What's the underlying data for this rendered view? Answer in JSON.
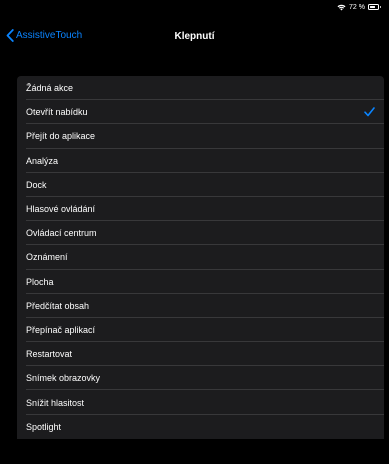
{
  "status_bar": {
    "battery_text": "72 %",
    "icons": [
      "wifi-icon",
      "battery-icon"
    ]
  },
  "nav": {
    "back_label": "AssistiveTouch",
    "title": "Klepnutí"
  },
  "colors": {
    "background": "#000000",
    "list_background": "#1c1c1e",
    "accent": "#0a84ff",
    "separator": "#38383a"
  },
  "list": {
    "selected_index": 1,
    "items": [
      {
        "label": "Žádná akce"
      },
      {
        "label": "Otevřít nabídku"
      },
      {
        "label": "Přejít do aplikace"
      },
      {
        "label": "Analýza"
      },
      {
        "label": "Dock"
      },
      {
        "label": "Hlasové ovládání"
      },
      {
        "label": "Ovládací centrum"
      },
      {
        "label": "Oznámení"
      },
      {
        "label": "Plocha"
      },
      {
        "label": "Předčítat obsah"
      },
      {
        "label": "Přepínač aplikací"
      },
      {
        "label": "Restartovat"
      },
      {
        "label": "Snímek obrazovky"
      },
      {
        "label": "Snížit hlasitost"
      },
      {
        "label": "Spotlight"
      }
    ]
  }
}
